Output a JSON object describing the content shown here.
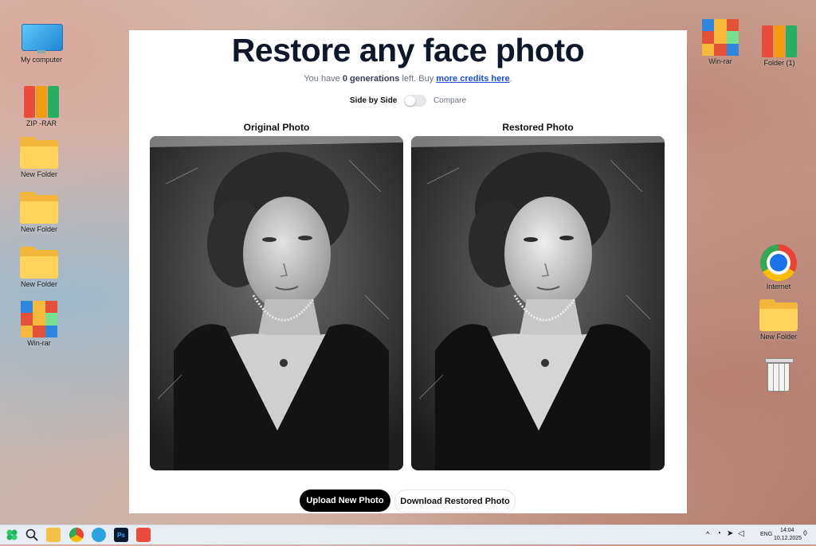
{
  "desktop": {
    "left_icons": [
      {
        "label": "My computer"
      },
      {
        "label": "ZIP -RAR"
      },
      {
        "label": "New Folder"
      },
      {
        "label": "New Folder"
      },
      {
        "label": "New Folder"
      },
      {
        "label": "Win-rar"
      }
    ],
    "right_icons": [
      {
        "label": "Win-rar"
      },
      {
        "label": "Folder (1)"
      },
      {
        "label": "Internet"
      },
      {
        "label": "New Folder"
      }
    ]
  },
  "app": {
    "title": "Restore any face photo",
    "subtitle_prefix": "You have",
    "generations_count": "0 generations",
    "subtitle_middle": "left. Buy",
    "credits_link": "more credits here",
    "subtitle_suffix": ".",
    "toggle_left_label": "Side by Side",
    "toggle_right_label": "Compare",
    "original_label": "Original Photo",
    "restored_label": "Restored Photo",
    "upload_button": "Upload New Photo",
    "download_button": "Download Restored Photo"
  },
  "taskbar": {
    "apps": [
      "start-icon",
      "search-icon",
      "file-explorer-icon",
      "chrome-icon",
      "telegram-icon",
      "photoshop-icon",
      "app-icon"
    ],
    "language": "ENG",
    "time": "14:04",
    "date": "10.12.2025"
  },
  "colors": {
    "title": "#0f172a",
    "link": "#1d4ed8",
    "primary_button": "#000000"
  }
}
